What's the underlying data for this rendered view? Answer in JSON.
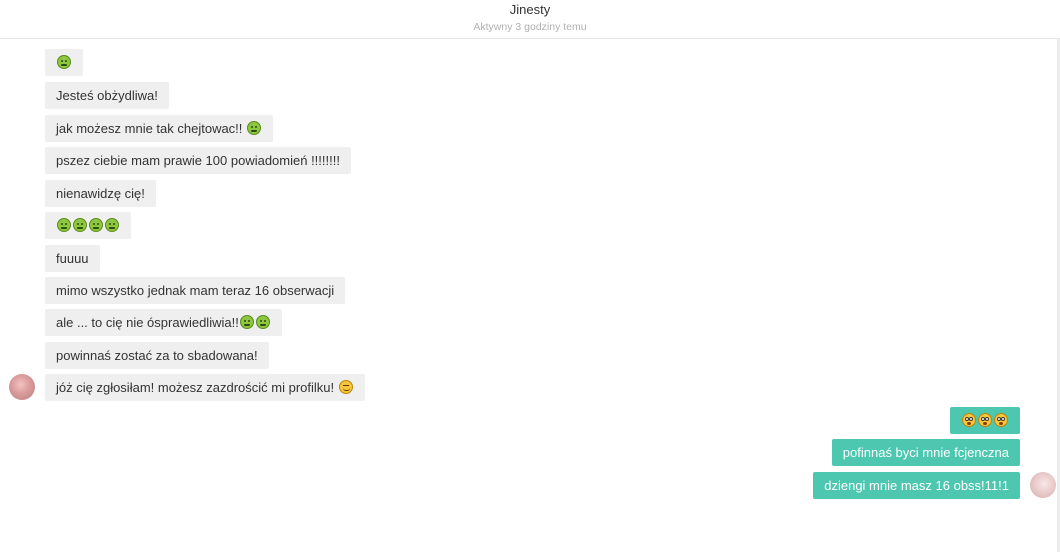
{
  "header": {
    "name": "Jinesty",
    "status": "Aktywny 3 godziny temu"
  },
  "colors": {
    "incoming_bubble": "#efefef",
    "outgoing_bubble": "#4dc7b0",
    "header_border": "#e6e6e6"
  },
  "incoming": [
    {
      "text": "",
      "icons": [
        "sick-face-icon"
      ]
    },
    {
      "text": "Jesteś obżydliwa!",
      "icons": []
    },
    {
      "text": "jak możesz mnie tak chejtowac!! ",
      "icons": [
        "sick-face-icon"
      ]
    },
    {
      "text": "pszez ciebie mam prawie 100 powiadomień !!!!!!!!",
      "icons": []
    },
    {
      "text": "nienawidzę cię!",
      "icons": []
    },
    {
      "text": "",
      "icons": [
        "sick-face-icon",
        "sick-face-icon",
        "sick-face-icon",
        "sick-face-icon"
      ]
    },
    {
      "text": "fuuuu",
      "icons": []
    },
    {
      "text": "mimo wszystko jednak mam teraz 16 obserwacji",
      "icons": []
    },
    {
      "text": "ale ... to cię nie ósprawiedliwia!!",
      "icons": [
        "sick-face-icon",
        "sick-face-icon"
      ]
    },
    {
      "text": "powinnaś zostać za to sbadowana!",
      "icons": []
    },
    {
      "text": "jóż cię zgłosiłam! możesz zazdrościć mi profilku! ",
      "icons": [
        "smirk-face-icon"
      ]
    }
  ],
  "outgoing": [
    {
      "text": "",
      "icons": [
        "flushed-face-icon",
        "flushed-face-icon",
        "flushed-face-icon"
      ]
    },
    {
      "text": "pofinnaś byci mnie fcjenczna",
      "icons": []
    },
    {
      "text": "dziengi mnie masz 16 obss!11!1",
      "icons": []
    }
  ]
}
